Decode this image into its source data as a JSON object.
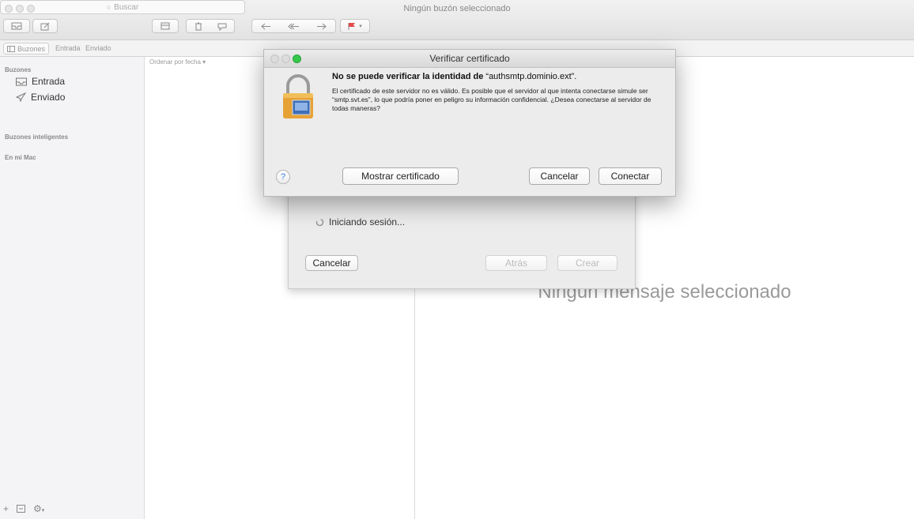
{
  "window": {
    "title": "Ningún buzón seleccionado"
  },
  "toolbar": {
    "search_placeholder": "Buscar",
    "icons": [
      "mailbox-icon",
      "compose-icon",
      "archive-icon",
      "trash-icon",
      "junk-icon",
      "reply-icon",
      "reply-all-icon",
      "forward-icon",
      "flag-icon"
    ]
  },
  "favorites": {
    "mailboxes_label": "Buzones",
    "inbox": "Entrada",
    "sent": "Enviado"
  },
  "sidebar": {
    "section_mailboxes": "Buzones",
    "items": [
      {
        "label": "Entrada",
        "icon": "inbox-icon"
      },
      {
        "label": "Enviado",
        "icon": "paper-plane-icon"
      }
    ],
    "section_smart": "Buzones inteligentes",
    "section_mac": "En mi Mac",
    "footer": {
      "add": "+",
      "gear": "⚙"
    }
  },
  "message_list": {
    "sort_label": "Ordenar por fecha"
  },
  "viewer": {
    "empty_text": "Ningún mensaje seleccionado"
  },
  "login_sheet": {
    "status": "Iniciando sesión...",
    "cancel": "Cancelar",
    "back": "Atrás",
    "create": "Crear"
  },
  "cert_dialog": {
    "title": "Verificar certificado",
    "heading_prefix": "No se puede verificar la identidad de",
    "heading_domain": "“authsmtp.dominio.ext”.",
    "body": "El certificado de este servidor no es válido. Es posible que el servidor al que intenta conectarse simule ser “smtp.svt.es”, lo que podría poner en peligro su información confidencial. ¿Desea conectarse al servidor de todas maneras?",
    "help": "?",
    "show_cert": "Mostrar certificado",
    "cancel": "Cancelar",
    "connect": "Conectar"
  },
  "colors": {
    "accent": "#3a7de8",
    "close": "#fc605b",
    "minimize": "#fdbc40",
    "zoom": "#34c84a"
  }
}
